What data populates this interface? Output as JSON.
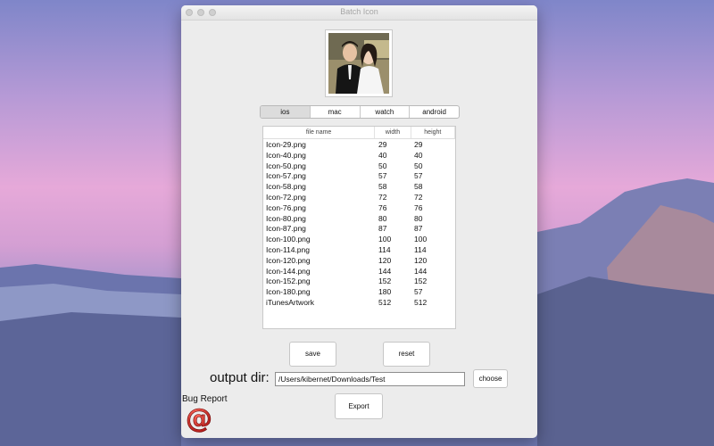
{
  "window": {
    "title": "Batch Icon"
  },
  "platform_tabs": [
    "ios",
    "mac",
    "watch",
    "android"
  ],
  "table": {
    "headers": [
      "file name",
      "width",
      "height"
    ],
    "rows": [
      [
        "Icon-29.png",
        "29",
        "29"
      ],
      [
        "Icon-40.png",
        "40",
        "40"
      ],
      [
        "Icon-50.png",
        "50",
        "50"
      ],
      [
        "Icon-57.png",
        "57",
        "57"
      ],
      [
        "Icon-58.png",
        "58",
        "58"
      ],
      [
        "Icon-72.png",
        "72",
        "72"
      ],
      [
        "Icon-76.png",
        "76",
        "76"
      ],
      [
        "Icon-80.png",
        "80",
        "80"
      ],
      [
        "Icon-87.png",
        "87",
        "87"
      ],
      [
        "Icon-100.png",
        "100",
        "100"
      ],
      [
        "Icon-114.png",
        "114",
        "114"
      ],
      [
        "Icon-120.png",
        "120",
        "120"
      ],
      [
        "Icon-144.png",
        "144",
        "144"
      ],
      [
        "Icon-152.png",
        "152",
        "152"
      ],
      [
        "Icon-180.png",
        "180",
        "57"
      ],
      [
        "iTunesArtwork",
        "512",
        "512"
      ]
    ]
  },
  "buttons": {
    "save": "save",
    "reset": "reset",
    "choose": "choose",
    "export": "Export"
  },
  "output": {
    "label": "output dir:",
    "path": "/Users/kibernet/Downloads/Test"
  },
  "bug_report": {
    "label": "Bug Report",
    "icon": "at-sign-icon"
  }
}
